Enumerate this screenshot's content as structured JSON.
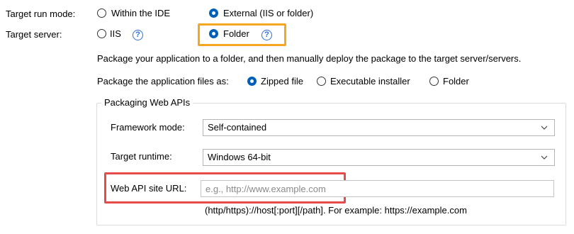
{
  "target_run_mode": {
    "label": "Target run mode:",
    "options": [
      {
        "label": "Within the IDE",
        "selected": false
      },
      {
        "label": "External (IIS or folder)",
        "selected": true
      }
    ]
  },
  "target_server": {
    "label": "Target server:",
    "options": [
      {
        "label": "IIS",
        "selected": false
      },
      {
        "label": "Folder",
        "selected": true
      }
    ],
    "help_glyph": "?"
  },
  "folder_description": "Package your application to a folder, and then manually deploy the package to the target server/servers.",
  "package_as": {
    "label": "Package the application files as:",
    "options": [
      {
        "label": "Zipped file",
        "selected": true
      },
      {
        "label": "Executable installer",
        "selected": false
      },
      {
        "label": "Folder",
        "selected": false
      }
    ]
  },
  "packaging_web_apis": {
    "title": "Packaging Web APIs",
    "framework_mode": {
      "label": "Framework mode:",
      "value": "Self-contained"
    },
    "target_runtime": {
      "label": "Target runtime:",
      "value": "Windows 64-bit"
    },
    "web_api_site_url": {
      "label": "Web API site URL:",
      "placeholder": "e.g., http://www.example.com",
      "value": ""
    },
    "url_hint": "(http/https)://host[:port][/path].  For example: https://example.com"
  },
  "colors": {
    "accent": "#005fb8",
    "help_icon": "#2f6fd6",
    "highlight_orange": "#f5a623",
    "highlight_red": "#e64b4b"
  }
}
